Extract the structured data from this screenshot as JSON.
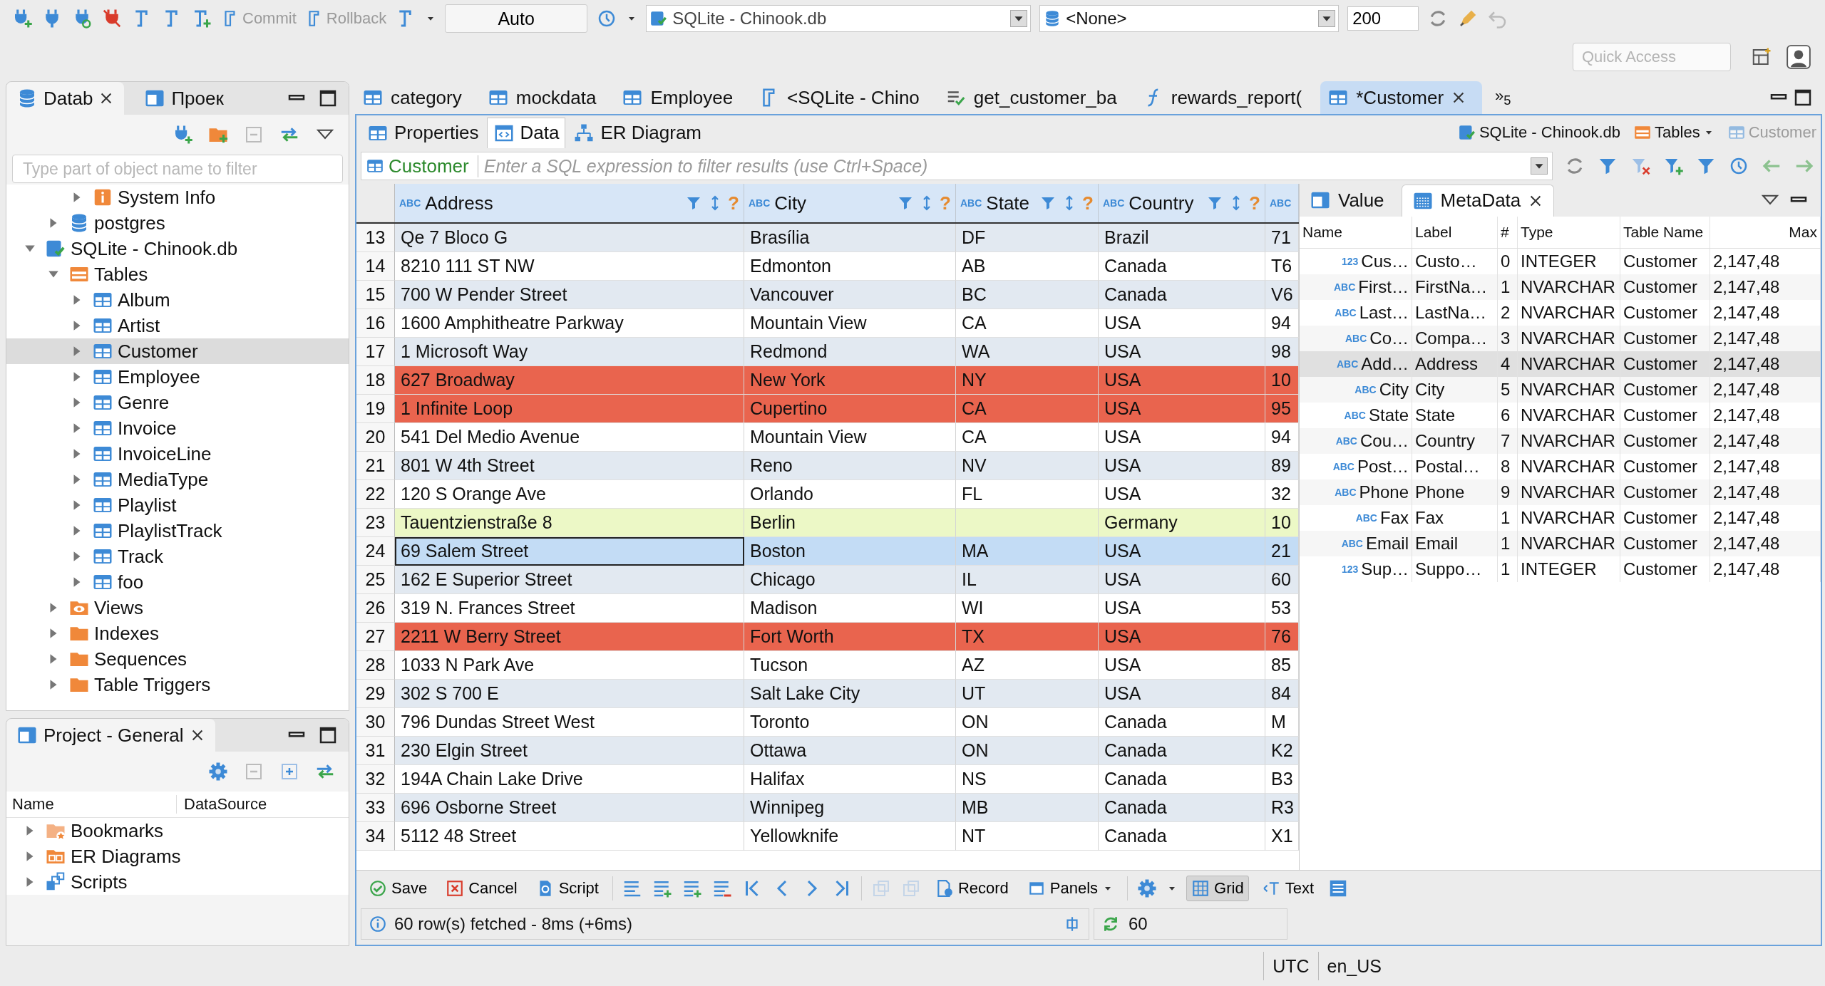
{
  "toolbar": {
    "commit": "Commit",
    "rollback": "Rollback",
    "transaction_mode": "Auto",
    "datasource": "SQLite - Chinook.db",
    "schema": "<None>",
    "fetch_size": "200",
    "quick_access": {
      "placeholder": "Quick Access"
    }
  },
  "navigator": {
    "tabs": [
      {
        "label": "Datab",
        "selected": true
      },
      {
        "label": "Проек",
        "selected": false
      }
    ],
    "filter": {
      "placeholder": "Type part of object name to filter"
    },
    "tree": [
      {
        "children": [
          {
            "children": [
              {
                "label": "System Info",
                "kind": "info",
                "expanded": false,
                "selected": false
              }
            ]
          },
          {
            "label": "postgres",
            "kind": "database",
            "expanded": false,
            "selected": false
          }
        ]
      },
      {
        "label": "SQLite - Chinook.db",
        "kind": "connection",
        "expanded": true,
        "selected": false,
        "children": [
          {
            "label": "Tables",
            "kind": "tables",
            "expanded": true,
            "selected": false,
            "children": [
              {
                "label": "Album",
                "kind": "table",
                "expanded": false,
                "selected": false
              },
              {
                "label": "Artist",
                "kind": "table",
                "expanded": false,
                "selected": false
              },
              {
                "label": "Customer",
                "kind": "table",
                "expanded": false,
                "selected": true
              },
              {
                "label": "Employee",
                "kind": "table",
                "expanded": false,
                "selected": false
              },
              {
                "label": "Genre",
                "kind": "table",
                "expanded": false,
                "selected": false
              },
              {
                "label": "Invoice",
                "kind": "table",
                "expanded": false,
                "selected": false
              },
              {
                "label": "InvoiceLine",
                "kind": "table",
                "expanded": false,
                "selected": false
              },
              {
                "label": "MediaType",
                "kind": "table",
                "expanded": false,
                "selected": false
              },
              {
                "label": "Playlist",
                "kind": "table",
                "expanded": false,
                "selected": false
              },
              {
                "label": "PlaylistTrack",
                "kind": "table",
                "expanded": false,
                "selected": false
              },
              {
                "label": "Track",
                "kind": "table",
                "expanded": false,
                "selected": false
              },
              {
                "label": "foo",
                "kind": "table",
                "expanded": false,
                "selected": false
              }
            ]
          },
          {
            "label": "Views",
            "kind": "views",
            "expanded": false,
            "selected": false
          },
          {
            "label": "Indexes",
            "kind": "folder",
            "expanded": false,
            "selected": false
          },
          {
            "label": "Sequences",
            "kind": "folder",
            "expanded": false,
            "selected": false
          },
          {
            "label": "Table Triggers",
            "kind": "folder",
            "expanded": false,
            "selected": false
          }
        ]
      }
    ]
  },
  "project": {
    "tab": "Project - General",
    "columns": [
      "Name",
      "DataSource"
    ],
    "items": [
      {
        "label": "Bookmarks",
        "kind": "bookmarks",
        "expanded": false
      },
      {
        "label": "ER Diagrams",
        "kind": "diagrams",
        "expanded": false
      },
      {
        "label": "Scripts",
        "kind": "scripts",
        "expanded": false
      }
    ]
  },
  "editor_tabs": [
    {
      "label": "category",
      "kind": "table",
      "selected": false
    },
    {
      "label": "mockdata",
      "kind": "table",
      "selected": false
    },
    {
      "label": "Employee",
      "kind": "table",
      "selected": false
    },
    {
      "label": "<SQLite - Chino",
      "kind": "sql",
      "selected": false
    },
    {
      "label": "get_customer_ba",
      "kind": "procedure",
      "selected": false
    },
    {
      "label": "rewards_report(",
      "kind": "function",
      "selected": false
    },
    {
      "label": "*Customer",
      "kind": "table",
      "selected": true
    }
  ],
  "editor_tabs_overflow": "»$_{5}$",
  "editor": {
    "subtabs": [
      {
        "label": "Properties",
        "kind": "properties",
        "selected": false
      },
      {
        "label": "Data",
        "kind": "data",
        "selected": true
      },
      {
        "label": "ER Diagram",
        "kind": "er",
        "selected": false
      }
    ],
    "breadcrumb": [
      "SQLite - Chinook.db",
      "Tables",
      "Customer"
    ],
    "filter": {
      "entity": "Customer",
      "placeholder": "Enter a SQL expression to filter results (use Ctrl+Space)"
    }
  },
  "grid": {
    "columns": [
      {
        "type_icon": "ABC",
        "name": "Address",
        "hint": "?"
      },
      {
        "type_icon": "ABC",
        "name": "City",
        "hint": "?"
      },
      {
        "type_icon": "ABC",
        "name": "State",
        "hint": "?"
      },
      {
        "type_icon": "ABC",
        "name": "Country",
        "hint": "?"
      },
      {
        "type_icon": "ABC"
      }
    ],
    "rows": [
      {
        "num": "13",
        "address": "Qe 7 Bloco G",
        "city": "Brasília",
        "state": "DF",
        "country": "Brazil",
        "column_5": "71",
        "selected": false
      },
      {
        "num": "14",
        "address": "8210 111 ST NW",
        "city": "Edmonton",
        "state": "AB",
        "country": "Canada",
        "column_5": "T6",
        "selected": false
      },
      {
        "num": "15",
        "address": "700 W Pender Street",
        "city": "Vancouver",
        "state": "BC",
        "country": "Canada",
        "column_5": "V6",
        "selected": false
      },
      {
        "num": "16",
        "address": "1600 Amphitheatre Parkway",
        "city": "Mountain View",
        "state": "CA",
        "country": "USA",
        "column_5": "94",
        "selected": false
      },
      {
        "num": "17",
        "address": "1 Microsoft Way",
        "city": "Redmond",
        "state": "WA",
        "country": "USA",
        "column_5": "98",
        "selected": false
      },
      {
        "num": "18",
        "address": "627 Broadway",
        "city": "New York",
        "state": "NY",
        "country": "USA",
        "column_5": "10",
        "selected": false,
        "color": "#e9644e"
      },
      {
        "num": "19",
        "address": "1 Infinite Loop",
        "city": "Cupertino",
        "state": "CA",
        "country": "USA",
        "column_5": "95",
        "selected": false,
        "color": "#e9644e"
      },
      {
        "num": "20",
        "address": "541 Del Medio Avenue",
        "city": "Mountain View",
        "state": "CA",
        "country": "USA",
        "column_5": "94",
        "selected": false
      },
      {
        "num": "21",
        "address": "801 W 4th Street",
        "city": "Reno",
        "state": "NV",
        "country": "USA",
        "column_5": "89",
        "selected": false
      },
      {
        "num": "22",
        "address": "120 S Orange Ave",
        "city": "Orlando",
        "state": "FL",
        "country": "USA",
        "column_5": "32",
        "selected": false
      },
      {
        "num": "23",
        "address": "Tauentzienstraße 8",
        "city": "Berlin",
        "country": "Germany",
        "column_5": "10",
        "selected": false,
        "color": "#ecf8c6"
      },
      {
        "num": "24",
        "address": "69 Salem Street",
        "city": "Boston",
        "state": "MA",
        "country": "USA",
        "column_5": "21",
        "selected": true
      },
      {
        "num": "25",
        "address": "162 E Superior Street",
        "city": "Chicago",
        "state": "IL",
        "country": "USA",
        "column_5": "60",
        "selected": false
      },
      {
        "num": "26",
        "address": "319 N. Frances Street",
        "city": "Madison",
        "state": "WI",
        "country": "USA",
        "column_5": "53",
        "selected": false
      },
      {
        "num": "27",
        "address": "2211 W Berry Street",
        "city": "Fort Worth",
        "state": "TX",
        "country": "USA",
        "column_5": "76",
        "selected": false,
        "color": "#e9644e"
      },
      {
        "num": "28",
        "address": "1033 N Park Ave",
        "city": "Tucson",
        "state": "AZ",
        "country": "USA",
        "column_5": "85",
        "selected": false
      },
      {
        "num": "29",
        "address": "302 S 700 E",
        "city": "Salt Lake City",
        "state": "UT",
        "country": "USA",
        "column_5": "84",
        "selected": false
      },
      {
        "num": "30",
        "address": "796 Dundas Street West",
        "city": "Toronto",
        "state": "ON",
        "country": "Canada",
        "column_5": "M",
        "selected": false
      },
      {
        "num": "31",
        "address": "230 Elgin Street",
        "city": "Ottawa",
        "state": "ON",
        "country": "Canada",
        "column_5": "K2",
        "selected": false
      },
      {
        "num": "32",
        "address": "194A Chain Lake Drive",
        "city": "Halifax",
        "state": "NS",
        "country": "Canada",
        "column_5": "B3",
        "selected": false
      },
      {
        "num": "33",
        "address": "696 Osborne Street",
        "city": "Winnipeg",
        "state": "MB",
        "country": "Canada",
        "column_5": "R3",
        "selected": false
      },
      {
        "num": "34",
        "address": "5112 48 Street",
        "city": "Yellowknife",
        "state": "NT",
        "country": "Canada",
        "column_5": "X1",
        "selected": false
      }
    ]
  },
  "side_panel": {
    "tabs": [
      {
        "label": "Value",
        "kind": "value",
        "selected": false
      },
      {
        "label": "MetaData",
        "kind": "metadata",
        "selected": true
      }
    ],
    "columns": [
      "Name",
      "Label",
      "#",
      "Type",
      "Table Name",
      "Max"
    ],
    "rows": [
      {
        "type_icon": "123",
        "cells": [
          "Cus…",
          "Custo…",
          "0",
          "INTEGER",
          "Customer",
          "2,147,48"
        ],
        "selected": false
      },
      {
        "type_icon": "ABC",
        "cells": [
          "First…",
          "FirstNa…",
          "1",
          "NVARCHAR",
          "Customer",
          "2,147,48"
        ],
        "selected": false
      },
      {
        "type_icon": "ABC",
        "cells": [
          "Last…",
          "LastNa…",
          "2",
          "NVARCHAR",
          "Customer",
          "2,147,48"
        ],
        "selected": false
      },
      {
        "type_icon": "ABC",
        "cells": [
          "Co…",
          "Compa…",
          "3",
          "NVARCHAR",
          "Customer",
          "2,147,48"
        ],
        "selected": false
      },
      {
        "type_icon": "ABC",
        "cells": [
          "Add…",
          "Address",
          "4",
          "NVARCHAR",
          "Customer",
          "2,147,48"
        ],
        "selected": true
      },
      {
        "type_icon": "ABC",
        "cells": [
          "City",
          "City",
          "5",
          "NVARCHAR",
          "Customer",
          "2,147,48"
        ],
        "selected": false
      },
      {
        "type_icon": "ABC",
        "cells": [
          "State",
          "State",
          "6",
          "NVARCHAR",
          "Customer",
          "2,147,48"
        ],
        "selected": false
      },
      {
        "type_icon": "ABC",
        "cells": [
          "Cou…",
          "Country",
          "7",
          "NVARCHAR",
          "Customer",
          "2,147,48"
        ],
        "selected": false
      },
      {
        "type_icon": "ABC",
        "cells": [
          "Post…",
          "Postal…",
          "8",
          "NVARCHAR",
          "Customer",
          "2,147,48"
        ],
        "selected": false
      },
      {
        "type_icon": "ABC",
        "cells": [
          "Phone",
          "Phone",
          "9",
          "NVARCHAR",
          "Customer",
          "2,147,48"
        ],
        "selected": false
      },
      {
        "type_icon": "ABC",
        "cells": [
          "Fax",
          "Fax",
          "1",
          "NVARCHAR",
          "Customer",
          "2,147,48"
        ],
        "selected": false
      },
      {
        "type_icon": "ABC",
        "cells": [
          "Email",
          "Email",
          "1",
          "NVARCHAR",
          "Customer",
          "2,147,48"
        ],
        "selected": false
      },
      {
        "type_icon": "123",
        "cells": [
          "Sup…",
          "Suppo…",
          "1",
          "INTEGER",
          "Customer",
          "2,147,48"
        ],
        "selected": false
      }
    ]
  },
  "results_toolbar": {
    "save": "Save",
    "cancel": "Cancel",
    "script": "Script",
    "record": "Record",
    "panels": "Panels",
    "views": [
      {
        "label": "Grid",
        "kind": "grid",
        "selected": true
      },
      {
        "label": "Text",
        "kind": "text",
        "selected": false
      }
    ]
  },
  "results_status": {
    "message": "60 row(s) fetched - 8ms (+6ms)",
    "count": "60"
  },
  "status_bar": [
    "UTC",
    "en_US"
  ]
}
